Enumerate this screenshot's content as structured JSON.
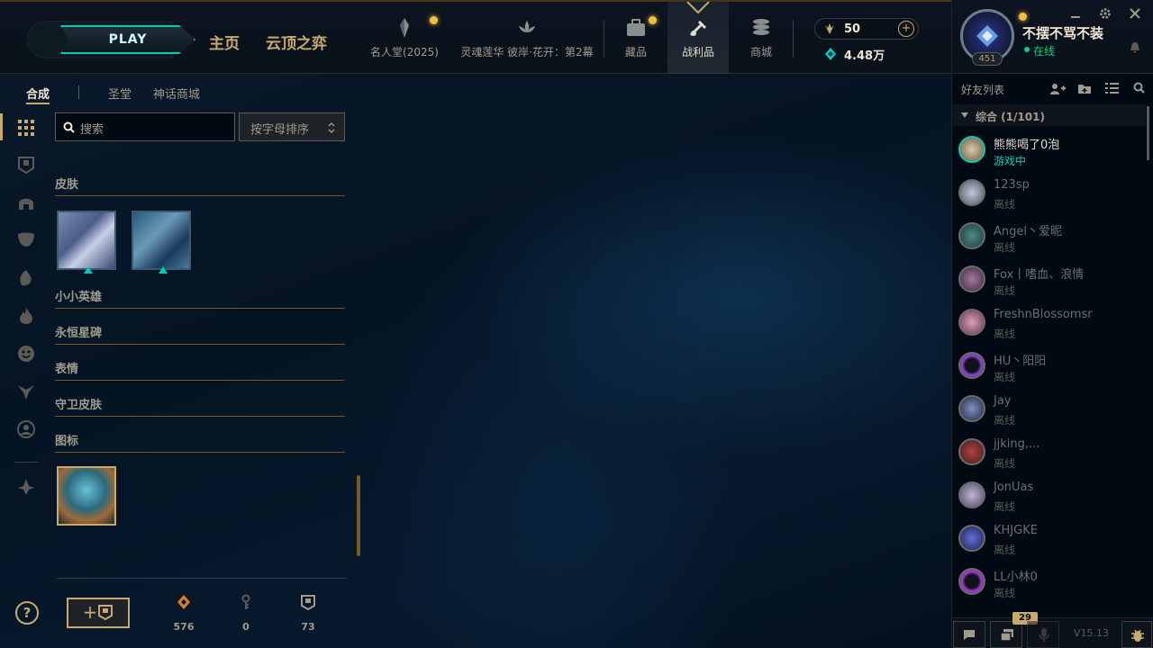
{
  "header": {
    "play_label": "PLAY",
    "nav_home": "主页",
    "nav_tft": "云顶之弈",
    "hall_of_fame": "名人堂(2025)",
    "event": "灵魂莲华 彼岸·花开：第2幕",
    "collection": "藏品",
    "loot": "战利品",
    "store": "商城",
    "rp_value": "50",
    "be_value": "4.48万"
  },
  "profile": {
    "summoner_name": "不摆不骂不装",
    "status": "在线",
    "level": "451"
  },
  "loot": {
    "tabs": [
      "合成",
      "圣堂",
      "神话商城"
    ],
    "search_placeholder": "搜索",
    "sort_label": "按字母排序",
    "categories": [
      "皮肤",
      "小小英雄",
      "永恒星碑",
      "表情",
      "守卫皮肤",
      "图标"
    ],
    "stats": {
      "orange_essence": "576",
      "keys": "0",
      "chests": "73"
    }
  },
  "friends": {
    "title": "好友列表",
    "group": "综合 (1/101)",
    "list": [
      {
        "name": "熊熊喝了0泡",
        "status": "游戏中"
      },
      {
        "name": "123sp",
        "status": "离线"
      },
      {
        "name": "Angel丶爱昵",
        "status": "离线"
      },
      {
        "name": "Fox丨嗜血、浪情",
        "status": "离线"
      },
      {
        "name": "FreshnBlossomsr",
        "status": "离线"
      },
      {
        "name": "HU丶阳阳",
        "status": "离线"
      },
      {
        "name": "Jay",
        "status": "离线"
      },
      {
        "name": "jjking,...",
        "status": "离线"
      },
      {
        "name": "JonUas",
        "status": "离线"
      },
      {
        "name": "KHJGKE",
        "status": "离线"
      },
      {
        "name": "LL小林0",
        "status": "离线"
      }
    ]
  },
  "bottom": {
    "notif_count": "29",
    "version": "V15.13"
  },
  "colors": {
    "gold": "#c8aa6e",
    "teal": "#0ac8b9",
    "online": "#0acf83"
  }
}
